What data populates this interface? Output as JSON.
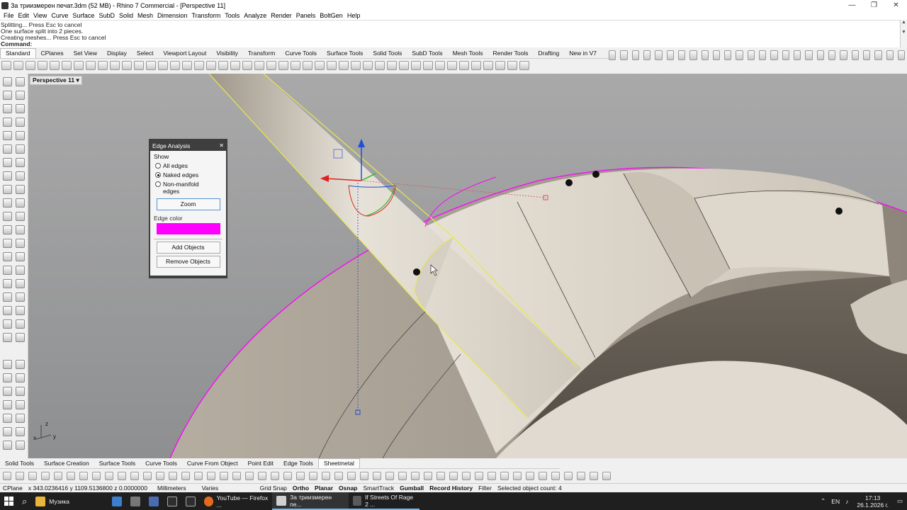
{
  "window": {
    "title": "За триизмерен печат.3dm (52 MB) - Rhino 7 Commercial - [Perspective 11]",
    "minimize": "—",
    "maximize": "❐",
    "close": "✕"
  },
  "menu": [
    "File",
    "Edit",
    "View",
    "Curve",
    "Surface",
    "SubD",
    "Solid",
    "Mesh",
    "Dimension",
    "Transform",
    "Tools",
    "Analyze",
    "Render",
    "Panels",
    "BoltGen",
    "Help"
  ],
  "command_history": [
    "Splitting... Press Esc to cancel",
    "One surface split into 2 pieces.",
    "Creating meshes... Press Esc to cancel"
  ],
  "command_prompt": "Command:",
  "toolbar_tabs": [
    "Standard",
    "CPlanes",
    "Set View",
    "Display",
    "Select",
    "Viewport Layout",
    "Visibility",
    "Transform",
    "Curve Tools",
    "Surface Tools",
    "Solid Tools",
    "SubD Tools",
    "Mesh Tools",
    "Render Tools",
    "Drafting",
    "New in V7"
  ],
  "viewport": {
    "label": "Perspective 11",
    "dropdown": "▾"
  },
  "axes": {
    "z": "z",
    "y": "y",
    "x": "x"
  },
  "edge_analysis": {
    "title": "Edge Analysis",
    "show_label": "Show",
    "options": [
      {
        "label": "All edges",
        "selected": false
      },
      {
        "label": "Naked edges",
        "selected": true
      },
      {
        "label": "Non-manifold edges",
        "selected": false
      }
    ],
    "zoom_button": "Zoom",
    "edge_color_label": "Edge color",
    "edge_color": "#ff00ff",
    "add_objects_button": "Add Objects",
    "remove_objects_button": "Remove Objects",
    "close": "✕"
  },
  "bottom_tabs": [
    "Solid Tools",
    "Surface Creation",
    "Surface Tools",
    "Curve Tools",
    "Curve From Object",
    "Point Edit",
    "Edge Tools",
    "Sheetmetal"
  ],
  "status_bar": {
    "cplane": "CPlane",
    "coords": "x 343.0236416  y 1109.5136800  z 0.0000000",
    "units": "Millimeters",
    "layer": "Varies",
    "grid_snap": "Grid Snap",
    "ortho": "Ortho",
    "planar": "Planar",
    "osnap": "Osnap",
    "smarttrack": "SmartTrack",
    "gumball": "Gumball",
    "record_history": "Record History",
    "filter": "Filter",
    "selected": "Selected object count: 4"
  },
  "taskbar": {
    "items": [
      {
        "label": "Музика",
        "active": false
      },
      {
        "label": "YouTube — Firefox ...",
        "active": false
      },
      {
        "label": "За триизмерен пе...",
        "active": true
      },
      {
        "label": "If Streets Of Rage 2 ...",
        "active": true
      }
    ],
    "language": "EN",
    "time": "17:13",
    "date": "26.1.2026 г."
  },
  "colors": {
    "naked_edge": "#ff00ff",
    "selection": "#e8e84a",
    "viewport_bg": "#9fa0a1",
    "model": "#d9d3c8"
  }
}
